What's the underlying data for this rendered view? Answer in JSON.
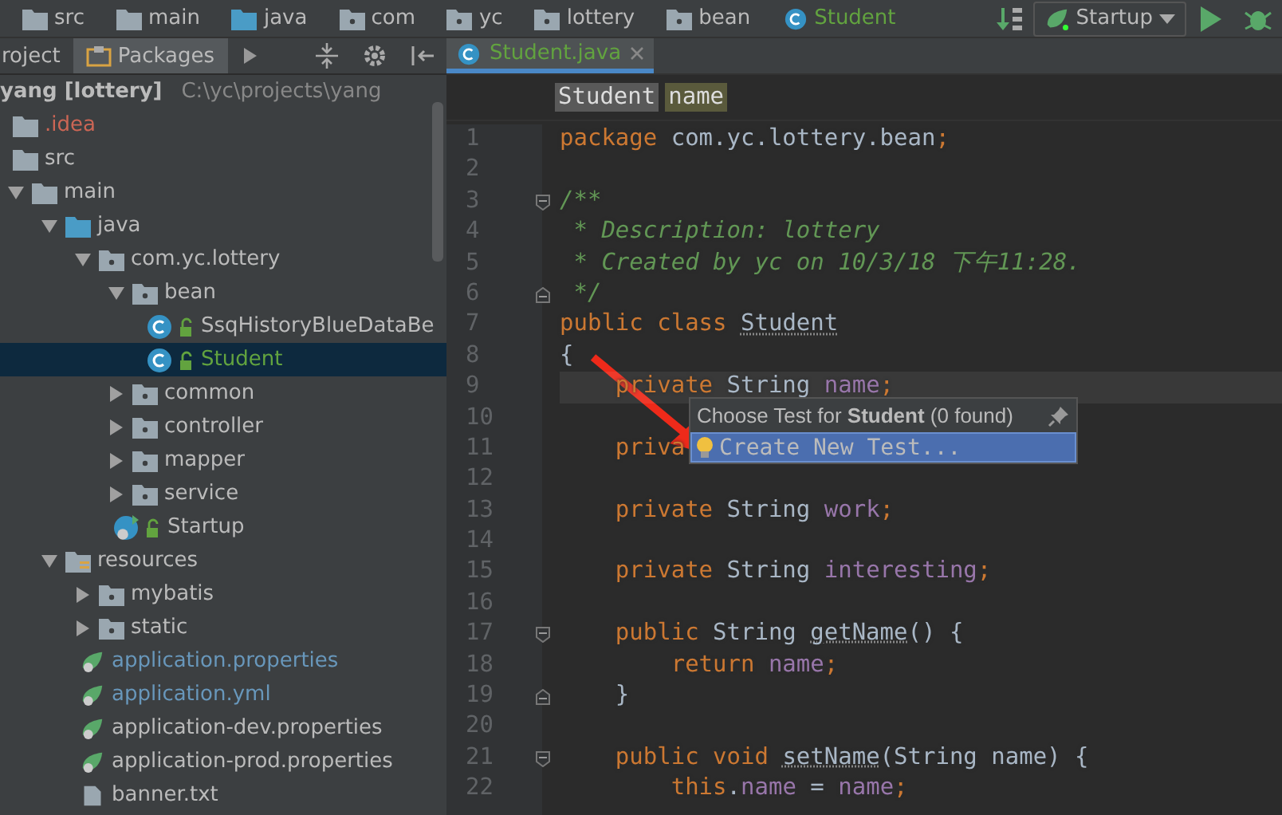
{
  "navigation_bar": {
    "crumbs": [
      {
        "label": "src",
        "kind": "folder"
      },
      {
        "label": "main",
        "kind": "folder"
      },
      {
        "label": "java",
        "kind": "source-folder"
      },
      {
        "label": "com",
        "kind": "package"
      },
      {
        "label": "yc",
        "kind": "package"
      },
      {
        "label": "lottery",
        "kind": "package"
      },
      {
        "label": "bean",
        "kind": "package"
      },
      {
        "label": "Student",
        "kind": "class"
      }
    ],
    "run_configuration": "Startup"
  },
  "tool_window": {
    "tabs": [
      {
        "label": "roject",
        "selected": false
      },
      {
        "label": "Packages",
        "selected": true
      }
    ]
  },
  "project_tree": {
    "root": {
      "name": "yang [lottery]",
      "path": "C:\\yc\\projects\\yang"
    },
    "children": [
      {
        "label": ".idea",
        "kind": "folder",
        "selected": false,
        "color": "#cc6655"
      },
      {
        "label": "src",
        "kind": "folder",
        "selected": false,
        "color": "#bbbbbb"
      },
      {
        "label": "main",
        "kind": "folder",
        "expanded": true,
        "selected": false,
        "color": "#bbbbbb",
        "children": [
          {
            "label": "java",
            "kind": "source-folder",
            "expanded": true,
            "selected": false,
            "color": "#bbbbbb",
            "children": [
              {
                "label": "com.yc.lottery",
                "kind": "package",
                "expanded": true,
                "selected": false,
                "color": "#bbbbbb",
                "children": [
                  {
                    "label": "bean",
                    "kind": "package",
                    "expanded": true,
                    "selected": false,
                    "color": "#bbbbbb",
                    "children": [
                      {
                        "label": "SsqHistoryBlueDataBe",
                        "kind": "class",
                        "selected": false,
                        "color": "#bbbbbb"
                      },
                      {
                        "label": "Student",
                        "kind": "class",
                        "selected": true,
                        "color": "#62a33f"
                      }
                    ]
                  },
                  {
                    "label": "common",
                    "kind": "package",
                    "expanded": false,
                    "selected": false,
                    "color": "#bbbbbb"
                  },
                  {
                    "label": "controller",
                    "kind": "package",
                    "expanded": false,
                    "selected": false,
                    "color": "#bbbbbb"
                  },
                  {
                    "label": "mapper",
                    "kind": "package",
                    "expanded": false,
                    "selected": false,
                    "color": "#bbbbbb"
                  },
                  {
                    "label": "service",
                    "kind": "package",
                    "expanded": false,
                    "selected": false,
                    "color": "#bbbbbb"
                  },
                  {
                    "label": "Startup",
                    "kind": "boot-class",
                    "selected": false,
                    "color": "#bbbbbb"
                  }
                ]
              }
            ]
          },
          {
            "label": "resources",
            "kind": "resources",
            "expanded": true,
            "selected": false,
            "color": "#bbbbbb",
            "children": [
              {
                "label": "mybatis",
                "kind": "package",
                "expanded": false,
                "selected": false,
                "color": "#bbbbbb"
              },
              {
                "label": "static",
                "kind": "package",
                "expanded": false,
                "selected": false,
                "color": "#bbbbbb"
              },
              {
                "label": "application.properties",
                "kind": "spring-file",
                "selected": false,
                "color": "#6897bb"
              },
              {
                "label": "application.yml",
                "kind": "spring-file",
                "selected": false,
                "color": "#6897bb"
              },
              {
                "label": "application-dev.properties",
                "kind": "spring-file",
                "selected": false,
                "color": "#bbbbbb"
              },
              {
                "label": "application-prod.properties",
                "kind": "spring-file",
                "selected": false,
                "color": "#bbbbbb"
              },
              {
                "label": "banner.txt",
                "kind": "text-file",
                "selected": false,
                "color": "#bbbbbb"
              }
            ]
          }
        ]
      }
    ]
  },
  "editor": {
    "tabs": [
      {
        "label": "Student.java",
        "selected": true
      }
    ],
    "breadcrumbs": [
      {
        "label": "Student",
        "selected": false
      },
      {
        "label": "name",
        "selected": true
      }
    ],
    "lines": [
      {
        "n": "1",
        "current": false,
        "tokens": [
          {
            "kind": "kw",
            "text": "package"
          },
          {
            "kind": "plain",
            "text": " com.yc.lottery.bean"
          },
          {
            "kind": "kw",
            "text": ";"
          }
        ]
      },
      {
        "n": "2",
        "current": false
      },
      {
        "n": "3",
        "current": false,
        "kind": "fold-start",
        "tokens": [
          {
            "kind": "comment",
            "text": "/**"
          }
        ]
      },
      {
        "n": "4",
        "current": false,
        "tokens": [
          {
            "kind": "comment",
            "text": " * Description: lottery"
          }
        ]
      },
      {
        "n": "5",
        "current": false,
        "tokens": [
          {
            "kind": "comment",
            "text": " * Created by yc on 10/3/18 下午11:28."
          }
        ]
      },
      {
        "n": "6",
        "current": false,
        "kind": "fold-end",
        "tokens": [
          {
            "kind": "comment",
            "text": " */"
          }
        ]
      },
      {
        "n": "7",
        "current": false,
        "tokens": [
          {
            "kind": "kw",
            "text": "public class "
          },
          {
            "kind": "decl",
            "text": "Student"
          }
        ]
      },
      {
        "n": "8",
        "current": false,
        "tokens": [
          {
            "kind": "plain",
            "text": "{"
          }
        ]
      },
      {
        "n": "9",
        "current": true,
        "tokens": [
          {
            "kind": "kw",
            "text": "    private "
          },
          {
            "kind": "plain",
            "text": "String "
          },
          {
            "kind": "field",
            "text": "name"
          },
          {
            "kind": "kw",
            "text": ";"
          }
        ]
      },
      {
        "n": "10",
        "current": false
      },
      {
        "n": "11",
        "current": false,
        "tokens": [
          {
            "kind": "kw",
            "text": "    priva"
          }
        ]
      },
      {
        "n": "12",
        "current": false
      },
      {
        "n": "13",
        "current": false,
        "tokens": [
          {
            "kind": "kw",
            "text": "    private "
          },
          {
            "kind": "plain",
            "text": "String "
          },
          {
            "kind": "field",
            "text": "work"
          },
          {
            "kind": "kw",
            "text": ";"
          }
        ]
      },
      {
        "n": "14",
        "current": false
      },
      {
        "n": "15",
        "current": false,
        "tokens": [
          {
            "kind": "kw",
            "text": "    private "
          },
          {
            "kind": "plain",
            "text": "String "
          },
          {
            "kind": "field",
            "text": "interesting"
          },
          {
            "kind": "kw",
            "text": ";"
          }
        ]
      },
      {
        "n": "16",
        "current": false
      },
      {
        "n": "17",
        "current": false,
        "kind": "fold-start",
        "tokens": [
          {
            "kind": "kw",
            "text": "    public "
          },
          {
            "kind": "plain",
            "text": "String "
          },
          {
            "kind": "decl",
            "text": "getName"
          },
          {
            "kind": "plain",
            "text": "() {"
          }
        ]
      },
      {
        "n": "18",
        "current": false,
        "tokens": [
          {
            "kind": "kw",
            "text": "        return "
          },
          {
            "kind": "field",
            "text": "name"
          },
          {
            "kind": "kw",
            "text": ";"
          }
        ]
      },
      {
        "n": "19",
        "current": false,
        "kind": "fold-end",
        "tokens": [
          {
            "kind": "plain",
            "text": "    }"
          }
        ]
      },
      {
        "n": "20",
        "current": false
      },
      {
        "n": "21",
        "current": false,
        "kind": "fold-start",
        "tokens": [
          {
            "kind": "kw",
            "text": "    public void "
          },
          {
            "kind": "decl",
            "text": "setName"
          },
          {
            "kind": "plain",
            "text": "(String name) {"
          }
        ]
      },
      {
        "n": "22",
        "current": false,
        "tokens": [
          {
            "kind": "kw",
            "text": "        this"
          },
          {
            "kind": "plain",
            "text": "."
          },
          {
            "kind": "field",
            "text": "name"
          },
          {
            "kind": "plain",
            "text": " = "
          },
          {
            "kind": "field",
            "text": "name"
          },
          {
            "kind": "kw",
            "text": ";"
          }
        ]
      }
    ]
  },
  "test_popup": {
    "title": "Choose Test for **Student** (0 found)",
    "items": [
      {
        "label": "Create New Test...",
        "selected": true
      }
    ]
  }
}
